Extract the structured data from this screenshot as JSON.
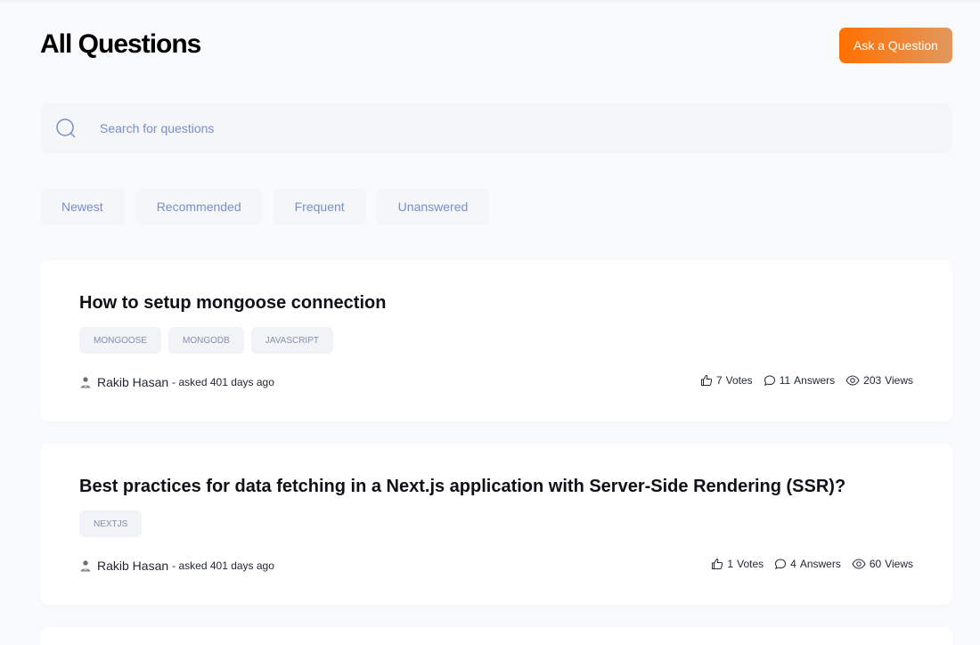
{
  "page_title": "All Questions",
  "ask_button_label": "Ask a Question",
  "search": {
    "placeholder": "Search for questions"
  },
  "filters": [
    "Newest",
    "Recommended",
    "Frequent",
    "Unanswered"
  ],
  "questions": [
    {
      "title": "How to setup mongoose connection",
      "tags": [
        "MONGOOSE",
        "MONGODB",
        "JAVASCRIPT"
      ],
      "author": "Rakib Hasan",
      "asked": "- asked 401 days ago",
      "votes": "7",
      "votes_label": "Votes",
      "answers": "11",
      "answers_label": "Answers",
      "views": "203",
      "views_label": "Views"
    },
    {
      "title": "Best practices for data fetching in a Next.js application with Server-Side Rendering (SSR)?",
      "tags": [
        "NEXTJS"
      ],
      "author": "Rakib Hasan",
      "asked": "- asked 401 days ago",
      "votes": "1",
      "votes_label": "Votes",
      "answers": "4",
      "answers_label": "Answers",
      "views": "60",
      "views_label": "Views"
    }
  ],
  "colors": {
    "accent_start": "#ff7000",
    "accent_end": "#e2985e",
    "muted_text": "#7b8ec8",
    "tag_text": "#858ead"
  }
}
